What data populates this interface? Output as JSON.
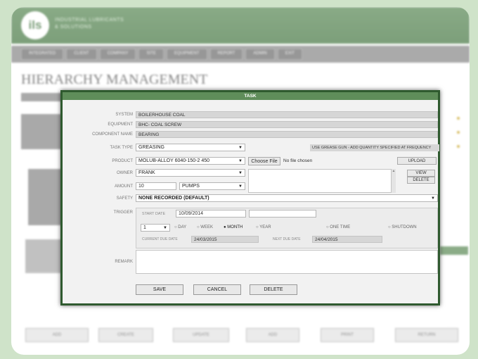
{
  "background": {
    "logo": "ils",
    "brand_line1": "INDUSTRIAL LUBRICANTS",
    "brand_line2": "& SOLUTIONS",
    "page_title": "HIERARCHY MANAGEMENT",
    "nav": [
      "INTEGRATED",
      "CLIENT",
      "COMPANY",
      "SITE",
      "EQUIPMENT",
      "REPORT",
      "ADMIN",
      "EXIT"
    ],
    "buttons": [
      "ADD",
      "CREATE",
      "UPDATE",
      "ADD",
      "PRINT",
      "RETURN"
    ]
  },
  "modal": {
    "title": "TASK",
    "system_label": "SYSTEM",
    "system_value": "BOILERHOUSE COAL",
    "equipment_label": "EQUIPMENT",
    "equipment_value": "BHC- COAL SCREW",
    "component_label": "COMPONENT NAME",
    "component_value": "BEARING",
    "tasktype_label": "TASK TYPE",
    "tasktype_value": "GREASING",
    "tasktype_note": "USE GREASE GUN - ADD QUANTITY SPECIFIED AT FREQUENCY",
    "product_label": "PRODUCT",
    "product_value": "MOLUB-ALLOY 6040-150-2 450",
    "choose_file": "Choose File",
    "no_file": "No file chosen",
    "upload": "UPLOAD",
    "view": "VIEW",
    "delete_small": "DELETE",
    "owner_label": "OWNER",
    "owner_value": "FRANK",
    "amount_label": "AMOUNT",
    "amount_value": "10",
    "amount_unit": "PUMPS",
    "safety_label": "SAFETY",
    "safety_value": "NONE RECORDED (DEFAULT)",
    "start_label": "START DATE",
    "start_value": "10/09/2014",
    "trigger_label": "TRIGGER",
    "trigger_value": "1",
    "radios": [
      "DAY",
      "WEEK",
      "MONTH",
      "YEAR"
    ],
    "selected_radio": "MONTH",
    "one_time": "ONE TIME",
    "shutdown": "SHUTDOWN",
    "current_label": "CURRENT DUE DATE",
    "current_value": "24/03/2015",
    "next_label": "NEXT DUE DATE",
    "next_value": "24/04/2015",
    "remark_label": "REMARK",
    "save": "SAVE",
    "cancel": "CANCEL",
    "delete": "DELETE"
  }
}
